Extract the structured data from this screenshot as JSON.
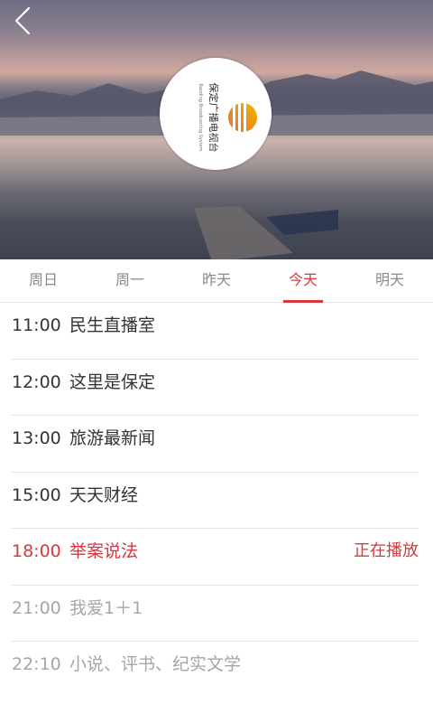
{
  "header": {
    "back_icon": "chevron-left-icon",
    "logo": {
      "name_cn": "保定广播电视台",
      "name_en": "Baoding Broadcasting System"
    }
  },
  "tabs": [
    {
      "label": "周日",
      "active": false
    },
    {
      "label": "周一",
      "active": false
    },
    {
      "label": "昨天",
      "active": false
    },
    {
      "label": "今天",
      "active": true
    },
    {
      "label": "明天",
      "active": false
    }
  ],
  "schedule": [
    {
      "time": "11:00",
      "title": "民生直播室",
      "status": "",
      "state": "past"
    },
    {
      "time": "12:00",
      "title": "这里是保定",
      "status": "",
      "state": "past"
    },
    {
      "time": "13:00",
      "title": "旅游最新闻",
      "status": "",
      "state": "past"
    },
    {
      "time": "15:00",
      "title": "天天财经",
      "status": "",
      "state": "past"
    },
    {
      "time": "18:00",
      "title": "举案说法",
      "status": "正在播放",
      "state": "playing"
    },
    {
      "time": "21:00",
      "title": "我爱1＋1",
      "status": "",
      "state": "future"
    },
    {
      "time": "22:10",
      "title": "小说、评书、纪实文学",
      "status": "",
      "state": "future"
    }
  ],
  "colors": {
    "accent": "#d9363e",
    "text": "#333333",
    "muted": "#a6a6a6",
    "tab_inactive": "#8a8a8a"
  }
}
